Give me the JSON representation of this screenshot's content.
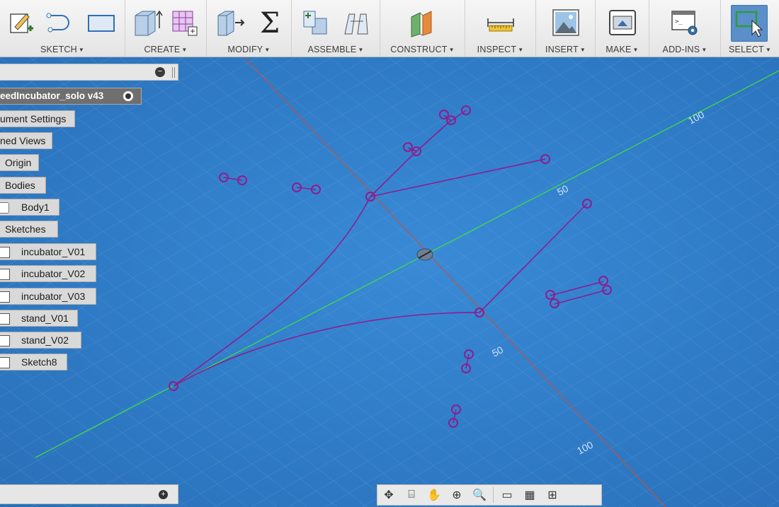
{
  "toolbar": {
    "groups": [
      {
        "label": "SKETCH",
        "tools": [
          "create-sketch-icon",
          "spline-icon",
          "rectangle-icon"
        ]
      },
      {
        "label": "CREATE",
        "tools": [
          "extrude-icon",
          "form-icon"
        ]
      },
      {
        "label": "MODIFY",
        "tools": [
          "press-pull-icon",
          "sum-icon"
        ]
      },
      {
        "label": "ASSEMBLE",
        "tools": [
          "new-component-icon",
          "joint-icon"
        ]
      },
      {
        "label": "CONSTRUCT",
        "tools": [
          "offset-plane-icon"
        ]
      },
      {
        "label": "INSPECT",
        "tools": [
          "measure-icon"
        ]
      },
      {
        "label": "INSERT",
        "tools": [
          "insert-image-icon"
        ]
      },
      {
        "label": "MAKE",
        "tools": [
          "3d-print-icon"
        ]
      },
      {
        "label": "ADD-INS",
        "tools": [
          "scripts-icon"
        ]
      },
      {
        "label": "SELECT",
        "tools": [
          "select-icon"
        ]
      }
    ]
  },
  "browser": {
    "root": "eedIncubator_solo v43",
    "nodes": [
      {
        "label": "ument Settings",
        "type": "folder"
      },
      {
        "label": "ned Views",
        "type": "folder"
      },
      {
        "label": "Origin",
        "type": "folder"
      },
      {
        "label": "Bodies",
        "type": "folder"
      },
      {
        "label": "Body1",
        "type": "body"
      },
      {
        "label": "Sketches",
        "type": "folder"
      },
      {
        "label": "incubator_V01",
        "type": "sketch"
      },
      {
        "label": "incubator_V02",
        "type": "sketch"
      },
      {
        "label": "incubator_V03",
        "type": "sketch"
      },
      {
        "label": "stand_V01",
        "type": "sketch"
      },
      {
        "label": "stand_V02",
        "type": "sketch"
      },
      {
        "label": "Sketch8",
        "type": "sketch"
      }
    ]
  },
  "grid_labels": {
    "a": "100",
    "b": "50",
    "c": "50",
    "d": "100"
  },
  "nav_bar": {
    "icons": [
      "orbit-icon",
      "look-at-icon",
      "pan-icon",
      "zoom-icon",
      "fit-icon",
      "display-settings-icon",
      "grid-settings-icon",
      "viewports-icon"
    ]
  },
  "colors": {
    "sketch": "#8b1f8f",
    "x_axis": "#c8503a",
    "y_axis": "#3fd94a",
    "canvas": "#2f7cc7"
  }
}
